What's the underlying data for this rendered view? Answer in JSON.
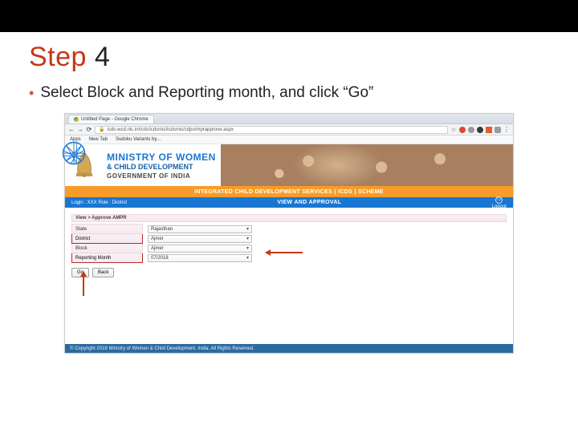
{
  "slide": {
    "step_label": "Step",
    "step_number": "4",
    "bullet_text": "Select Block and Reporting month, and click “Go”"
  },
  "browser": {
    "tab_title": "Untitled Page - Google Chrome",
    "url": "icds-wcd.nic.in/icds/icdsmis/icdsmis/cdpo/mprapprove.aspx",
    "bookmarks": [
      "Apps",
      "New Tab",
      "Sudoku Variants by..."
    ]
  },
  "banner": {
    "ministry_line1": "MINISTRY OF WOMEN",
    "ministry_line2": "& CHILD DEVELOPMENT",
    "govt": "GOVERNMENT OF INDIA"
  },
  "stripes": {
    "scheme_title": "INTEGRATED CHILD DEVELOPMENT SERVICES ( ICDS ) SCHEME",
    "left_login": "Login : XXX   Role : District",
    "view_title": "VIEW AND APPROVAL",
    "logout_label": "Logout"
  },
  "form": {
    "breadcrumb": "View > Approve AMPR",
    "rows": [
      {
        "label": "State",
        "value": "Rajasthan"
      },
      {
        "label": "District",
        "value": "Ajmer"
      },
      {
        "label": "Block",
        "value": "Ajmer"
      },
      {
        "label": "Reporting Month",
        "value": "07/2018"
      }
    ],
    "buttons": {
      "go": "Go",
      "back": "Back"
    }
  },
  "footer": {
    "copyright": "© Copyright 2018 Ministry of Women & Child Development, India. All Rights Reserved."
  }
}
